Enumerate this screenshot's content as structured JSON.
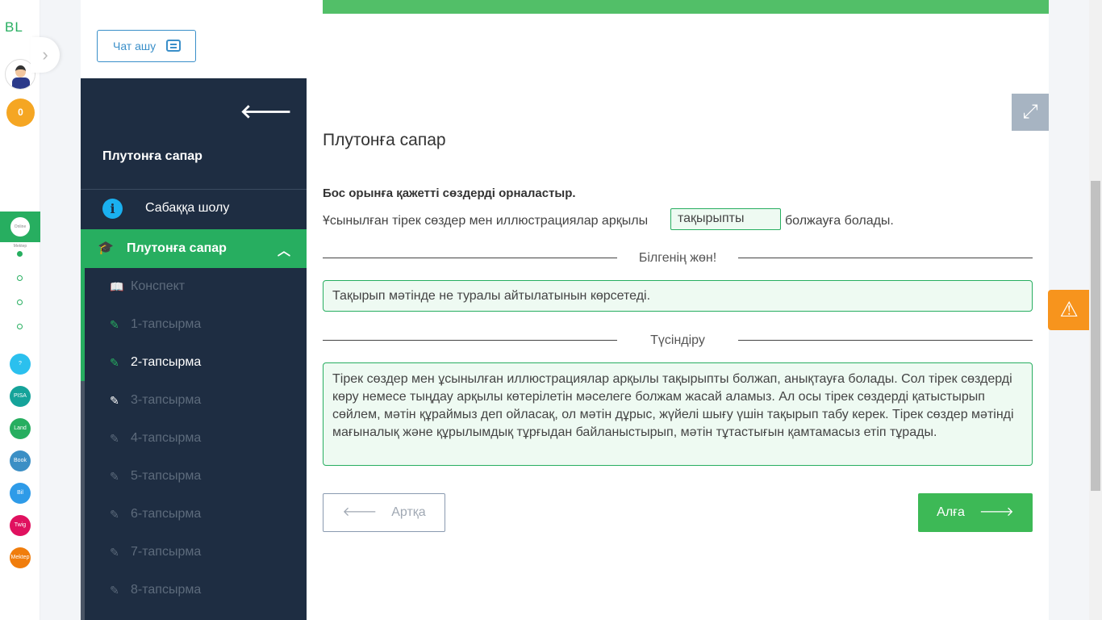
{
  "rail": {
    "logo": "BL",
    "coins": "0",
    "online_label": "Online Mektep",
    "apps": [
      {
        "name": "help",
        "label": "?",
        "color": "#2bc0ee"
      },
      {
        "name": "pisa",
        "label": "PISA",
        "color": "#15a39a"
      },
      {
        "name": "bilim-land",
        "label": "Land",
        "color": "#27ae60"
      },
      {
        "name": "bilim-book",
        "label": "Book",
        "color": "#3b8fc5"
      },
      {
        "name": "bil",
        "label": "Bil",
        "color": "#2e9be8"
      },
      {
        "name": "twig",
        "label": "Twig",
        "color": "#e0115f"
      },
      {
        "name": "mektep",
        "label": "Mektep",
        "color": "#f07d0c"
      }
    ]
  },
  "chat": {
    "label": "Чат ашу"
  },
  "nav": {
    "title": "Плутонға сапар",
    "overview": "Сабаққа шолу",
    "section": "Плутонға сапар",
    "items": [
      "Конспект",
      "1-тапсырма",
      "2-тапсырма",
      "3-тапсырма",
      "4-тапсырма",
      "5-тапсырма",
      "6-тапсырма",
      "7-тапсырма",
      "8-тапсырма"
    ]
  },
  "main": {
    "title": "Плутонға сапар",
    "instruction": "Бос орынға қажетті сөздерді орналастыр.",
    "sentence_before": "Ұсынылған тірек сөздер мен иллюстрациялар арқылы",
    "gap_value": "тақырыпты",
    "sentence_after": "болжауға болады.",
    "know_label": "Білгенің жөн!",
    "know_text": "Тақырып мәтінде не туралы айтылатынын көрсетеді.",
    "explain_label": "Түсіндіру",
    "explain_text": "Тірек сөздер мен ұсынылған иллюстрациялар арқылы тақырыпты болжап, анықтауға болады. Сол тірек сөздерді көру немесе тыңдау арқылы көтерілетін мәселеге болжам жасай аламыз. Ал осы тірек сөздерді қатыстырып сөйлем, мәтін құраймыз деп ойласақ, ол мәтін дұрыс, жүйелі шығу үшін тақырып табу керек. Тірек сөздер мәтінді мағыналық және құрылымдық тұрғыдан байланыстырып, мәтін тұтастығын қамтамасыз етіп тұрады.",
    "prev": "Артқа",
    "next": "Алға"
  }
}
